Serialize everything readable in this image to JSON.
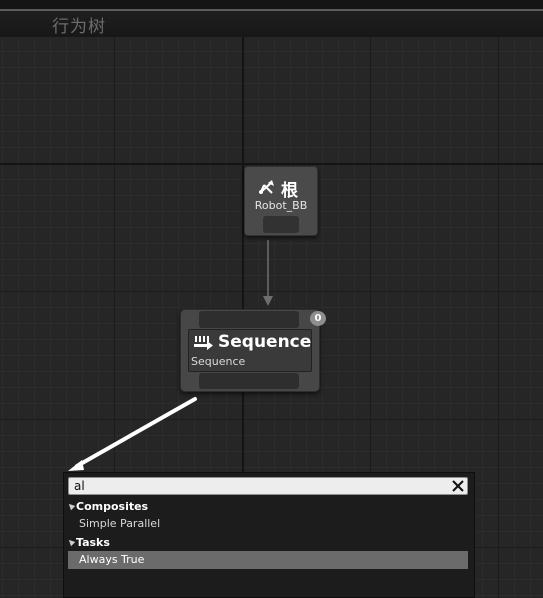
{
  "graph": {
    "title": "行为树"
  },
  "root_node": {
    "title": "根",
    "subtitle": "Robot_BB",
    "icon": "root-branch-icon"
  },
  "sequence_node": {
    "title": "Sequence",
    "subtitle": "Sequence",
    "execution_index": "0",
    "icon": "sequence-icon"
  },
  "search_popup": {
    "query": "al",
    "clear_icon": "close-icon",
    "categories": [
      {
        "name": "Composites",
        "items": [
          {
            "label": "Simple Parallel",
            "selected": false
          }
        ]
      },
      {
        "name": "Tasks",
        "items": [
          {
            "label": "Always True",
            "selected": true
          }
        ]
      }
    ]
  },
  "colors": {
    "graph_background": "#262626",
    "node_body": "#474747",
    "selected_row": "#6b6b6b",
    "connector": "#ffffff"
  }
}
